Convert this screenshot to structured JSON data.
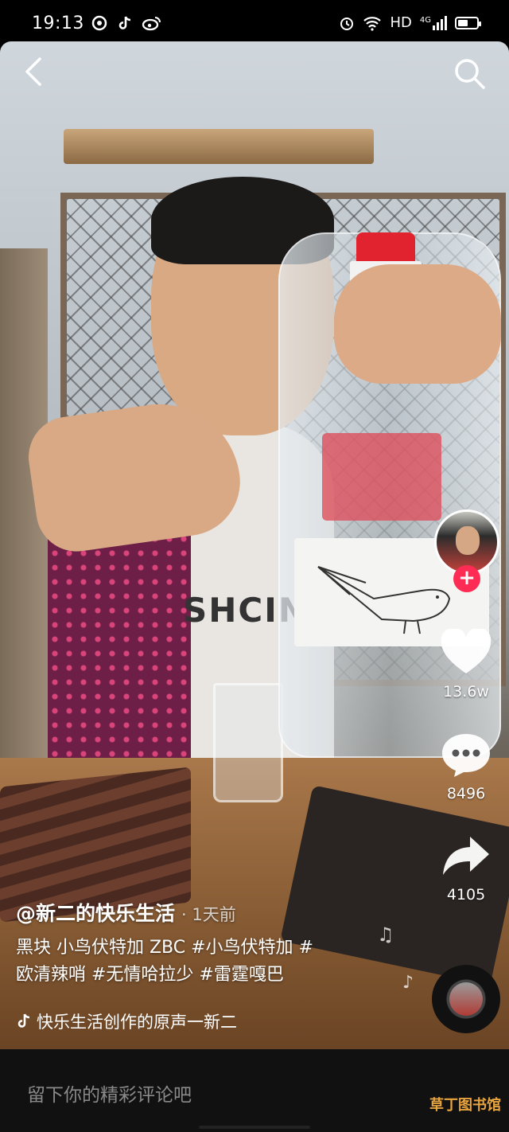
{
  "status_bar": {
    "time": "19:13",
    "app_icons": [
      "netease-icon",
      "tiktok-icon",
      "weibo-icon"
    ],
    "network_label": "HD",
    "signal_label": "4G"
  },
  "video": {
    "shirt_text": "SHCIN"
  },
  "right_rail": {
    "like_count": "13.6w",
    "comment_count": "8496",
    "share_count": "4105"
  },
  "caption": {
    "author": "@新二的快乐生活",
    "time_ago": "· 1天前",
    "description_line1": "黑块 小鸟伏特加 ZBC #小鸟伏特加 #",
    "description_line2": "欧清辣哨 #无情哈拉少 #雷霆嘎巴",
    "sound": "快乐生活创作的原声一新二"
  },
  "comment_bar": {
    "placeholder": "留下你的精彩评论吧",
    "watermark": "草丁图书馆"
  },
  "colors": {
    "follow": "#fe2c55",
    "bottle_cap": "#e0232e"
  }
}
